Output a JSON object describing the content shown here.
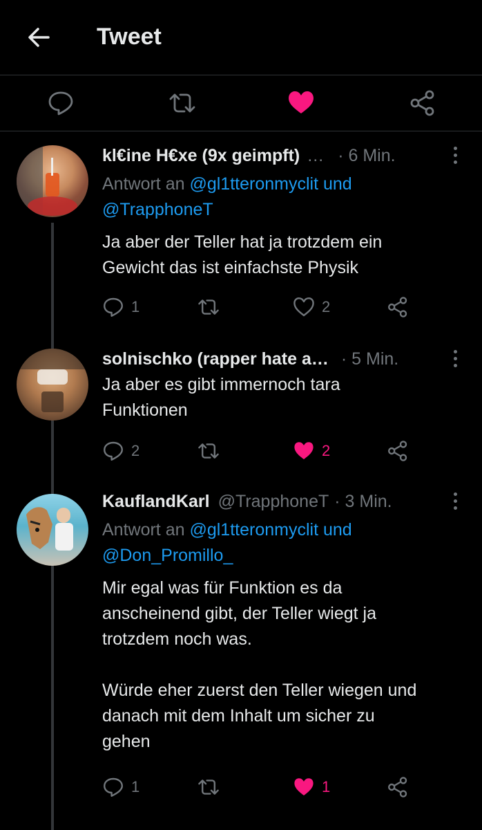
{
  "header": {
    "title": "Tweet"
  },
  "colors": {
    "accent": "#1d9bf0",
    "like": "#f91880",
    "muted": "#71767b",
    "text": "#e7e9ea",
    "background": "#000000"
  },
  "action_bar": {
    "icons": [
      "reply-icon",
      "retweet-icon",
      "like-icon-filled",
      "share-icon"
    ]
  },
  "tweets": [
    {
      "name": "kl€ine H€xe (9x geimpft)",
      "name_suffix": "…",
      "handle": "",
      "time": "· 6 Min.",
      "reply_prefix": "Antwort an",
      "reply_to_line1": "@gl1tteronmyclit und",
      "reply_to_line2": "@TrapphoneT",
      "text": "Ja aber der Teller hat ja trotzdem ein\nGewicht das ist einfachste Physik",
      "replies": "1",
      "retweets": "",
      "likes": "2",
      "liked": false
    },
    {
      "name": "solnischko (rapper hate a…",
      "name_suffix": "",
      "handle": "",
      "time": "· 5 Min.",
      "text": "Ja aber es gibt immernoch tara\nFunktionen",
      "replies": "2",
      "retweets": "",
      "likes": "2",
      "liked": true
    },
    {
      "name": "KauflandKarl",
      "name_suffix": "",
      "handle": "@TrapphoneT",
      "time": "· 3 Min.",
      "reply_prefix": "Antwort an",
      "reply_to_line1": "@gl1tteronmyclit und",
      "reply_to_line2": "@Don_Promillo_",
      "text": "Mir egal was für Funktion es da\nanscheinend gibt, der Teller wiegt ja\ntrotzdem noch was.\n\nWürde eher zuerst den Teller wiegen und\ndanach mit dem Inhalt um sicher zu\ngehen",
      "replies": "1",
      "retweets": "",
      "likes": "1",
      "liked": true
    }
  ]
}
